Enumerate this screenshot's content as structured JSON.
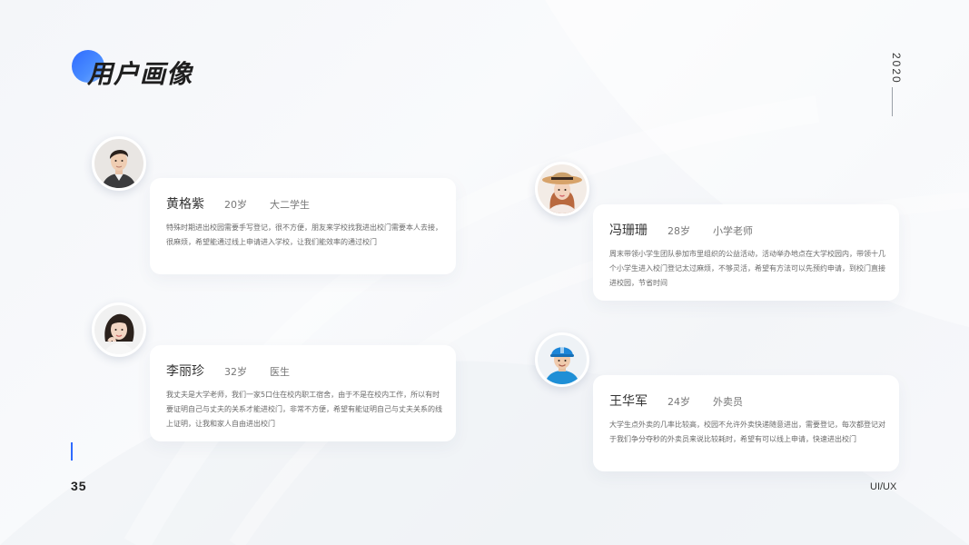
{
  "header": {
    "title": "用户画像",
    "year": "2020"
  },
  "footer": {
    "page_number": "35",
    "label": "UI/UX"
  },
  "accent_color": "#2f6bff",
  "personas": [
    {
      "name": "黄格紫",
      "age": "20岁",
      "role": "大二学生",
      "description": "特殊时期进出校园需要手写登记，很不方便，朋友来学校找我进出校门需要本人去接，很麻烦，希望能通过线上申请进入学校，让我们能效率的通过校门",
      "avatar_icon": "young-man-avatar-icon"
    },
    {
      "name": "冯珊珊",
      "age": "28岁",
      "role": "小学老师",
      "description": "周末带领小学生团队参加市里组织的公益活动，活动举办地点在大学校园内，带领十几个小学生进入校门登记太过麻烦，不够灵活，希望有方法可以先预约申请，到校门直接进校园，节省时间",
      "avatar_icon": "woman-with-hat-avatar-icon"
    },
    {
      "name": "李丽珍",
      "age": "32岁",
      "role": "医生",
      "description": "我丈夫是大学老师，我们一家5口住在校内职工宿舍，由于不是在校内工作，所以有时要证明自己与丈夫的关系才能进校门，非常不方便，希望有能证明自己与丈夫关系的线上证明，让我和家人自由进出校门",
      "avatar_icon": "woman-short-hair-avatar-icon"
    },
    {
      "name": "王华军",
      "age": "24岁",
      "role": "外卖员",
      "description": "大学生点外卖的几率比较高，校园不允许外卖快递随意进出，需要登记，每次都登记对于我们争分夺秒的外卖员来说比较耗时，希望有可以线上申请，快速进出校门",
      "avatar_icon": "delivery-man-helmet-avatar-icon"
    }
  ]
}
